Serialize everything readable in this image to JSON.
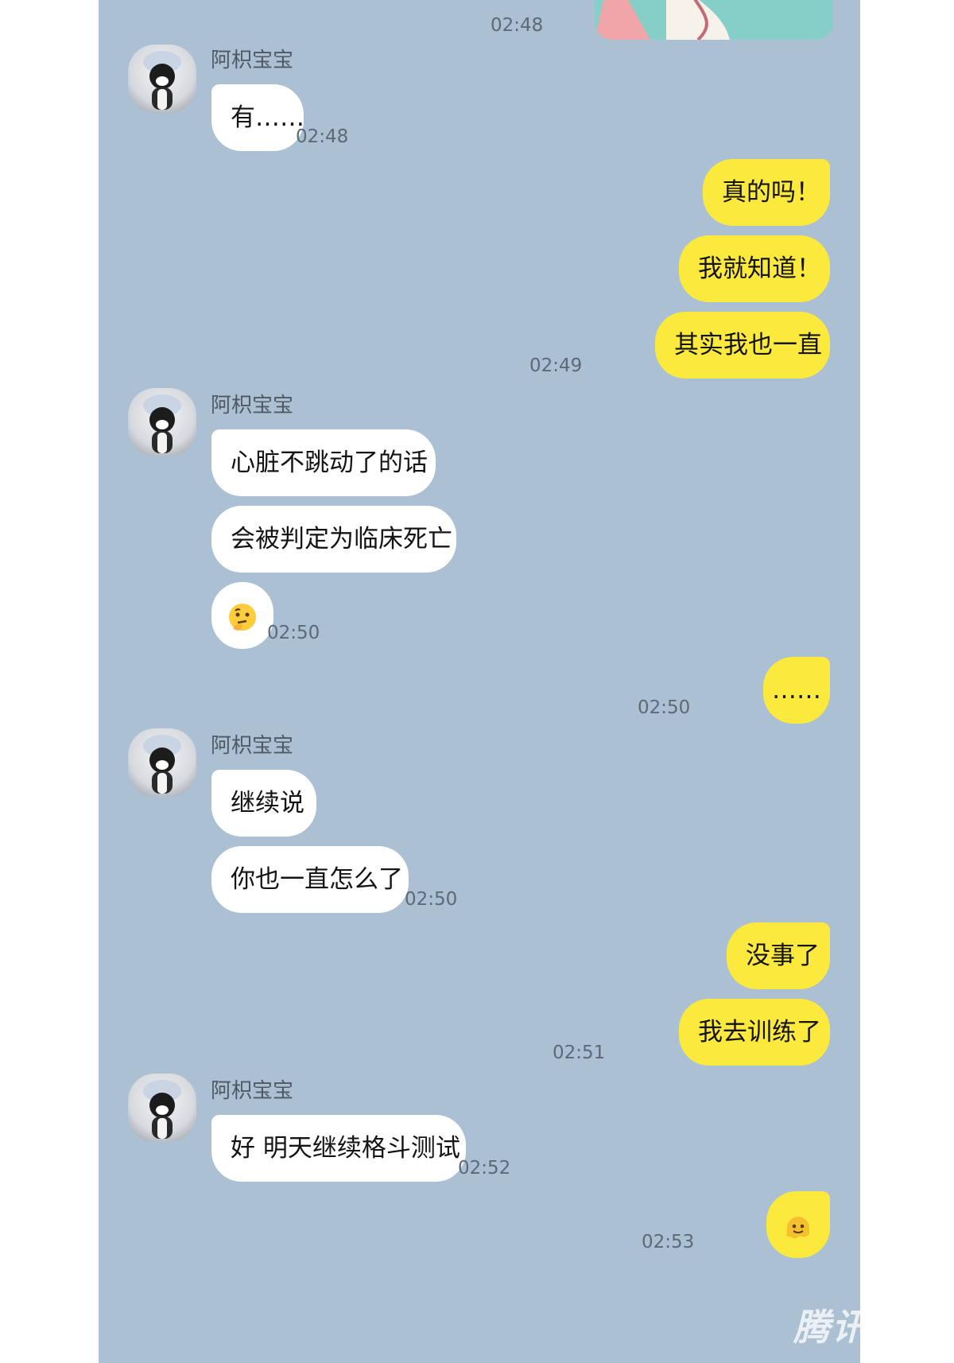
{
  "contact_name": "阿枳宝宝",
  "watermark": "腾讯动漫",
  "colors": {
    "background": "#abc1d3",
    "incoming_bubble": "#ffffff",
    "outgoing_bubble": "#fce93e"
  },
  "messages": {
    "m0_time": "02:48",
    "g1": {
      "sender": "阿枳宝宝",
      "text": "有……",
      "time": "02:48"
    },
    "g2": {
      "texts": [
        "真的吗！",
        "我就知道！",
        "其实我也一直"
      ],
      "time": "02:49"
    },
    "g3": {
      "sender": "阿枳宝宝",
      "texts": [
        "心脏不跳动了的话",
        "会被判定为临床死亡"
      ],
      "emoji": "thinking-face",
      "time": "02:50"
    },
    "g4": {
      "text": "……",
      "time": "02:50"
    },
    "g5": {
      "sender": "阿枳宝宝",
      "texts": [
        "继续说",
        "你也一直怎么了"
      ],
      "time": "02:50"
    },
    "g6": {
      "texts": [
        "没事了",
        "我去训练了"
      ],
      "time": "02:51"
    },
    "g7": {
      "sender": "阿枳宝宝",
      "text": "好 明天继续格斗测试",
      "time": "02:52"
    },
    "g8": {
      "emoji": "melting-face",
      "time": "02:53"
    }
  }
}
